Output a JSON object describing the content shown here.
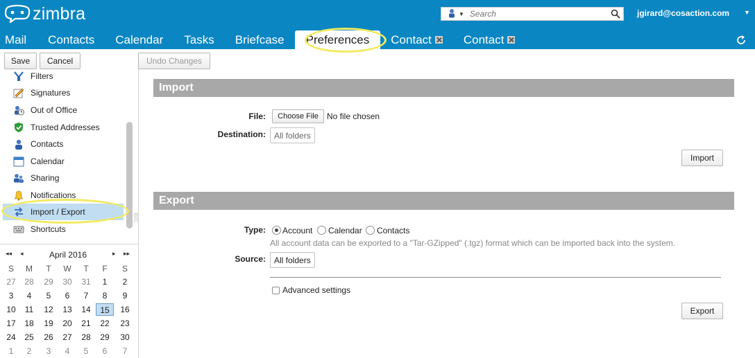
{
  "header": {
    "logo_text": "zimbra",
    "search": {
      "placeholder": "Search"
    },
    "user_name": "jgirard@cosaction.com",
    "user_menu_icon": "caret-down-icon",
    "refresh_icon": "refresh-icon"
  },
  "app_tabs": [
    {
      "label": "Mail"
    },
    {
      "label": "Contacts"
    },
    {
      "label": "Calendar"
    },
    {
      "label": "Tasks"
    },
    {
      "label": "Briefcase"
    },
    {
      "label": "Preferences",
      "active": true
    },
    {
      "label": "Contact",
      "closable": true
    },
    {
      "label": "Contact",
      "closable": true
    }
  ],
  "toolbar": {
    "save_label": "Save",
    "cancel_label": "Cancel",
    "undo_label": "Undo Changes"
  },
  "nav": {
    "items": [
      {
        "label": "Filters",
        "icon": "filter-icon"
      },
      {
        "label": "Signatures",
        "icon": "signature-icon"
      },
      {
        "label": "Out of Office",
        "icon": "out-of-office-icon"
      },
      {
        "label": "Trusted Addresses",
        "icon": "shield-check-icon"
      },
      {
        "label": "Contacts",
        "icon": "contact-person-icon"
      },
      {
        "label": "Calendar",
        "icon": "calendar-icon"
      },
      {
        "label": "Sharing",
        "icon": "sharing-icon"
      },
      {
        "label": "Notifications",
        "icon": "bell-icon"
      },
      {
        "label": "Import / Export",
        "icon": "import-export-icon",
        "selected": true
      },
      {
        "label": "Shortcuts",
        "icon": "keyboard-icon"
      }
    ]
  },
  "mini_calendar": {
    "title": "April 2016",
    "nav_prev_year": "◂◂",
    "nav_prev_month": "◂",
    "nav_next_month": "▸",
    "nav_next_year": "▸▸",
    "weekdays": [
      "S",
      "M",
      "T",
      "W",
      "T",
      "F",
      "S"
    ],
    "weeks": [
      [
        "27",
        "28",
        "29",
        "30",
        "31",
        "1",
        "2"
      ],
      [
        "3",
        "4",
        "5",
        "6",
        "7",
        "8",
        "9"
      ],
      [
        "10",
        "11",
        "12",
        "13",
        "14",
        "15",
        "16"
      ],
      [
        "17",
        "18",
        "19",
        "20",
        "21",
        "22",
        "23"
      ],
      [
        "24",
        "25",
        "26",
        "27",
        "28",
        "29",
        "30"
      ],
      [
        "1",
        "2",
        "3",
        "4",
        "5",
        "6",
        "7"
      ]
    ],
    "today": "15"
  },
  "import": {
    "header": "Import",
    "file_label": "File:",
    "choose_file_label": "Choose File",
    "no_file_text": "No file chosen",
    "destination_label": "Destination:",
    "destination_value": "All folders",
    "import_button": "Import"
  },
  "export": {
    "header": "Export",
    "type_label": "Type:",
    "types": [
      {
        "label": "Account",
        "checked": true
      },
      {
        "label": "Calendar",
        "checked": false
      },
      {
        "label": "Contacts",
        "checked": false
      }
    ],
    "type_hint": "All account data can be exported to a \"Tar-GZipped\" (.tgz) format which can be imported back into the system.",
    "source_label": "Source:",
    "source_value": "All folders",
    "advanced_label": "Advanced settings",
    "advanced_checked": false,
    "export_button": "Export"
  },
  "colors": {
    "header_bg": "#0a86c3",
    "section_header_bg": "#a8a8a8",
    "selected_nav_bg": "#c0ddf1",
    "highlight_ring": "#f1ea5f"
  }
}
